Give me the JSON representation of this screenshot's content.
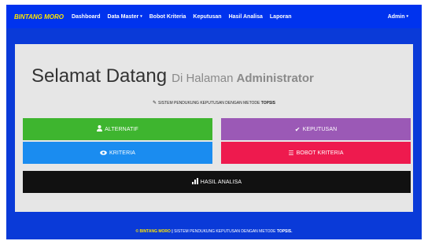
{
  "navbar": {
    "brand": "BINTANG MORO",
    "items": [
      {
        "label": "Dashboard"
      },
      {
        "label": "Data Master",
        "caret": "▾"
      },
      {
        "label": "Bobot Kriteria"
      },
      {
        "label": "Keputusan"
      },
      {
        "label": "Hasil Analisa"
      },
      {
        "label": "Laporan"
      }
    ],
    "admin_label": "Admin",
    "admin_caret": "▾"
  },
  "welcome": {
    "main": "Selamat Datang",
    "sub": "Di Halaman",
    "admin": "Administrator"
  },
  "subtitle": {
    "icon": "pencil-icon",
    "text": "SISTEM PENDUKUNG KEPUTUSAN DENGAN METODE",
    "bold": "TOPSIS"
  },
  "buttons": {
    "alternatif": {
      "label": "ALTERNATIF",
      "icon": "user-icon",
      "color": "#3eb52f"
    },
    "keputusan": {
      "label": "KEPUTUSAN",
      "icon": "checkmark-icon",
      "color": "#9b59b6"
    },
    "kriteria": {
      "label": "KRITERIA",
      "icon": "eye-icon",
      "color": "#1a8cf0"
    },
    "bobot_kriteria": {
      "label": "BOBOT KRITERIA",
      "icon": "list-icon",
      "color": "#ee1a4e"
    },
    "hasil_analisa": {
      "label": "HASIL ANALISA",
      "icon": "bar-chart-icon",
      "color": "#111111"
    }
  },
  "footer": {
    "copyright": "© BINTANG MORO",
    "separator": "|",
    "text": "SISTEM PENDUKUNG KEPUTUSAN DENGAN METODE",
    "bold": "TOPSIS."
  },
  "colors": {
    "navbar": "#0033ee",
    "frame": "#0a3ad8",
    "panel": "#e6e6e6",
    "brand": "#ffe600"
  }
}
